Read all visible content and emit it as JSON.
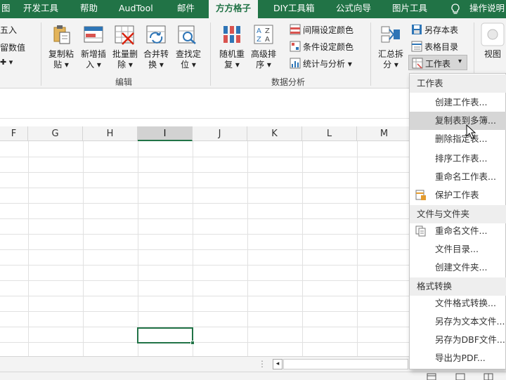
{
  "tabs": [
    {
      "label": "图",
      "active": false
    },
    {
      "label": "开发工具",
      "active": false
    },
    {
      "label": "帮助",
      "active": false
    },
    {
      "label": "AudTool",
      "active": false
    },
    {
      "label": "邮件",
      "active": false
    },
    {
      "label": "方方格子",
      "active": true
    },
    {
      "label": "DIY工具箱",
      "active": false
    },
    {
      "label": "公式向导",
      "active": false
    },
    {
      "label": "图片工具",
      "active": false
    },
    {
      "label": "操作说明",
      "active": false
    }
  ],
  "ribbon": {
    "left_partial": {
      "round": "五入",
      "keep": "留数值"
    },
    "edit_group": {
      "label": "编辑",
      "copy_paste": [
        "复制粘",
        "贴"
      ],
      "insert": [
        "新增插",
        "入"
      ],
      "batch_delete": [
        "批量删",
        "除"
      ],
      "merge_convert": [
        "合并转",
        "换"
      ],
      "find_locate": [
        "查找定",
        "位"
      ]
    },
    "analysis_group": {
      "label": "数据分析",
      "random_repeat": [
        "随机重",
        "复"
      ],
      "advanced_sort": [
        "高级排",
        "序"
      ],
      "interval_color": "间隔设定颜色",
      "condition_color": "条件设定颜色",
      "stats": "统计与分析"
    },
    "right_group": {
      "summary_split": [
        "汇总拆",
        "分"
      ],
      "save_as_sheet": "另存本表",
      "table_index": "表格目录",
      "worksheet": "工作表",
      "view": "视图"
    }
  },
  "columns": [
    "F",
    "G",
    "H",
    "I",
    "J",
    "K",
    "L",
    "M"
  ],
  "selected_column": "I",
  "menu": {
    "sections": [
      {
        "title": "工作表",
        "items": [
          {
            "label": "创建工作表...",
            "icon": null
          },
          {
            "label": "复制表到多簿...",
            "icon": null,
            "hover": true
          },
          {
            "label": "删除指定表...",
            "icon": null
          },
          {
            "label": "排序工作表...",
            "icon": null
          },
          {
            "label": "重命名工作表...",
            "icon": null
          },
          {
            "label": "保护工作表",
            "icon": "protect-sheet-icon"
          }
        ]
      },
      {
        "title": "文件与文件夹",
        "items": [
          {
            "label": "重命名文件...",
            "icon": "rename-file-icon"
          },
          {
            "label": "文件目录...",
            "icon": null
          },
          {
            "label": "创建文件夹...",
            "icon": null
          }
        ]
      },
      {
        "title": "格式转换",
        "items": [
          {
            "label": "文件格式转换...",
            "icon": null
          },
          {
            "label": "另存为文本文件...",
            "icon": null
          },
          {
            "label": "另存为DBF文件...",
            "icon": null
          },
          {
            "label": "导出为PDF...",
            "icon": null
          }
        ]
      }
    ]
  },
  "colors": {
    "brand": "#217346",
    "ribbon_bg": "#f3f3f3",
    "menu_hover": "#d6d6d6",
    "section_bg": "#eeeeee"
  }
}
